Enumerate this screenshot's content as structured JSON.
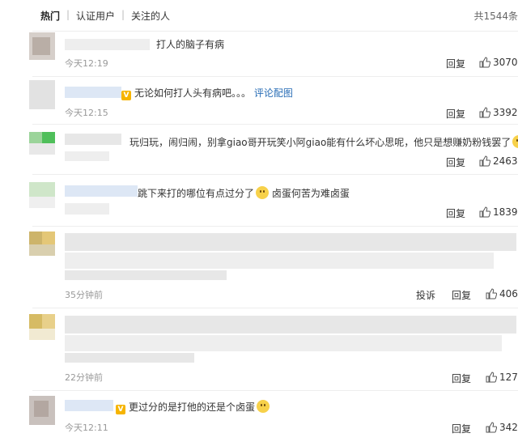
{
  "tabs": [
    {
      "label": "热门"
    },
    {
      "label": "认证用户"
    },
    {
      "label": "关注的人"
    }
  ],
  "total_label": "共1544条",
  "comments": [
    {
      "text": "打人的脑子有病",
      "time": "今天12:19",
      "reply": "回复",
      "likes": "3070"
    },
    {
      "text": "无论如何打人头有病吧。。。",
      "link": "评论配图",
      "time": "今天12:15",
      "reply": "回复",
      "likes": "3392"
    },
    {
      "text": "玩归玩，闹归闹，别拿giao哥开玩笑小阿giao能有什么坏心思呢，他只是想赚奶粉钱罢了",
      "reply": "回复",
      "likes": "2463"
    },
    {
      "text": "跳下来打的哪位有点过分了",
      "text2": "卤蛋何苦为难卤蛋",
      "reply": "回复",
      "likes": "1839"
    },
    {
      "time": "35分钟前",
      "report": "投诉",
      "reply": "回复",
      "likes": "406"
    },
    {
      "time": "22分钟前",
      "reply": "回复",
      "likes": "127"
    },
    {
      "text": "更过分的是打他的还是个卤蛋",
      "time": "今天12:11",
      "reply": "回复",
      "likes": "342"
    }
  ],
  "icons": {
    "like": "thumbs-up-icon",
    "vip": "vip-badge-icon",
    "emoji": "laughing-emoji-icon"
  },
  "colors": {
    "link": "#2a6eb6",
    "vip": "#f6b400",
    "time": "#999999"
  }
}
